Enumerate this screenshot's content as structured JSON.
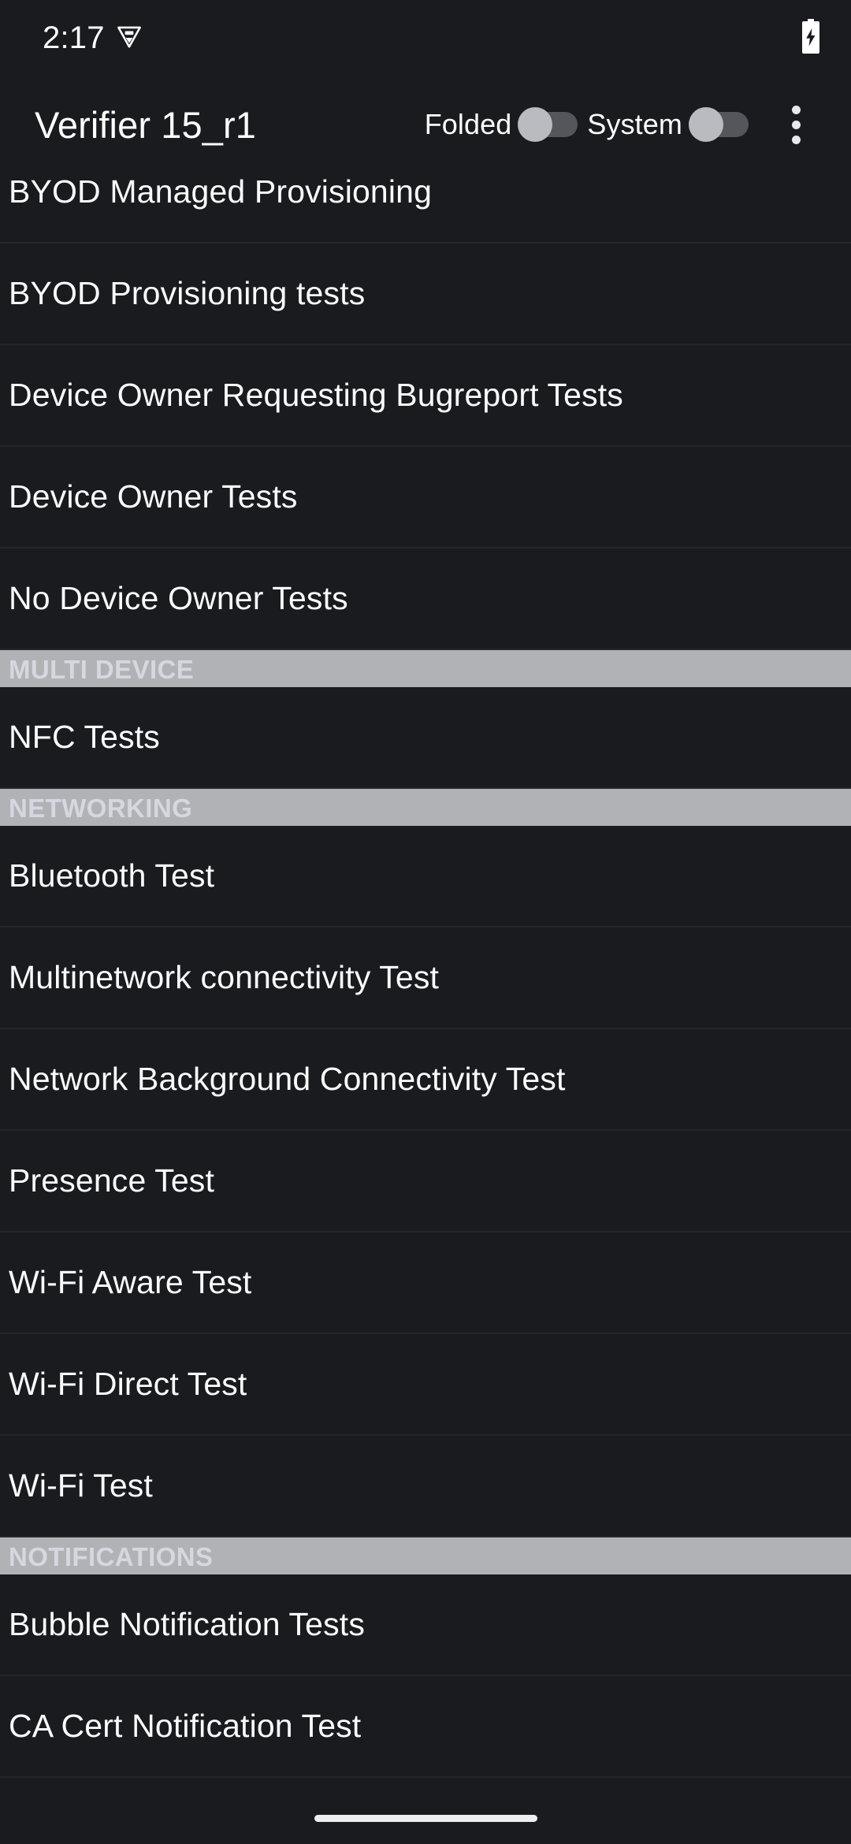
{
  "status_bar": {
    "time": "2:17",
    "left_icon": "debug-triangle-icon",
    "battery_icon": "battery-charging-icon"
  },
  "app_bar": {
    "title": "Verifier 15_r1",
    "switches": [
      {
        "label": "Folded",
        "state": "off"
      },
      {
        "label": "System",
        "state": "off"
      }
    ],
    "overflow_icon": "more-vert-icon"
  },
  "colors": {
    "background": "#1a1b1f",
    "divider": "#25262b",
    "section_header_bg": "#b1b2b6",
    "section_header_text": "#d6d7e0",
    "row_text": "#fbfbfd",
    "switch_track": "#55565c",
    "switch_thumb": "#b9bbc0",
    "home_indicator": "#eceef0"
  },
  "list": [
    {
      "type": "row",
      "label": "BYOD Managed Provisioning"
    },
    {
      "type": "row",
      "label": "BYOD Provisioning tests"
    },
    {
      "type": "row",
      "label": "Device Owner Requesting Bugreport Tests"
    },
    {
      "type": "row",
      "label": "Device Owner Tests"
    },
    {
      "type": "row",
      "label": "No Device Owner Tests"
    },
    {
      "type": "header",
      "label": "MULTI DEVICE"
    },
    {
      "type": "row",
      "label": "NFC Tests"
    },
    {
      "type": "header",
      "label": "NETWORKING"
    },
    {
      "type": "row",
      "label": "Bluetooth Test"
    },
    {
      "type": "row",
      "label": "Multinetwork connectivity Test"
    },
    {
      "type": "row",
      "label": "Network Background Connectivity Test"
    },
    {
      "type": "row",
      "label": "Presence Test"
    },
    {
      "type": "row",
      "label": "Wi-Fi Aware Test"
    },
    {
      "type": "row",
      "label": "Wi-Fi Direct Test"
    },
    {
      "type": "row",
      "label": "Wi-Fi Test"
    },
    {
      "type": "header",
      "label": "NOTIFICATIONS"
    },
    {
      "type": "row",
      "label": "Bubble Notification Tests"
    },
    {
      "type": "row",
      "label": "CA Cert Notification Test"
    }
  ],
  "nav_bar": {
    "home_indicator": "home-indicator"
  }
}
